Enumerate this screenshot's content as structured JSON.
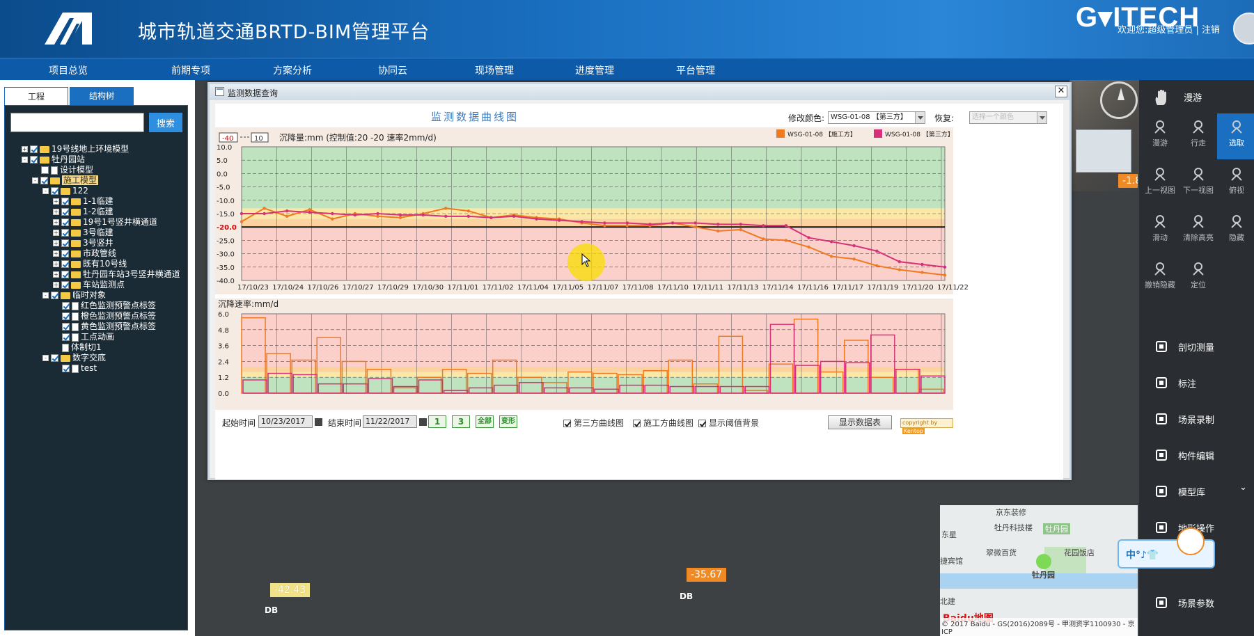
{
  "header": {
    "title": "城市轨道交通BRTD-BIM管理平台",
    "brand": "G▾ITECH",
    "welcome": "欢迎您:超级管理员 | 注销"
  },
  "nav": [
    "项目总览",
    "前期专项",
    "方案分析",
    "协同云",
    "现场管理",
    "进度管理",
    "平台管理"
  ],
  "left_panel": {
    "tabs": [
      "工程",
      "结构树"
    ],
    "search_placeholder": "",
    "search_button": "搜索",
    "tree": [
      {
        "label": "19号线地上环境模型",
        "indent": 0,
        "exp": "+",
        "cb": true,
        "icon": "folder"
      },
      {
        "label": "牡丹园站",
        "indent": 0,
        "exp": "-",
        "cb": true,
        "icon": "folder"
      },
      {
        "label": "设计模型",
        "indent": 1,
        "exp": "",
        "cb": false,
        "icon": "doc"
      },
      {
        "label": "施工模型",
        "indent": 1,
        "exp": "-",
        "cb": true,
        "icon": "folder",
        "highlight": true
      },
      {
        "label": "122",
        "indent": 2,
        "exp": "-",
        "cb": true,
        "icon": "folder"
      },
      {
        "label": "1-1临建",
        "indent": 3,
        "exp": "+",
        "cb": true,
        "icon": "folder"
      },
      {
        "label": "1-2临建",
        "indent": 3,
        "exp": "+",
        "cb": true,
        "icon": "folder"
      },
      {
        "label": "19号1号竖井横通道",
        "indent": 3,
        "exp": "+",
        "cb": true,
        "icon": "folder"
      },
      {
        "label": "3号临建",
        "indent": 3,
        "exp": "+",
        "cb": true,
        "icon": "folder"
      },
      {
        "label": "3号竖井",
        "indent": 3,
        "exp": "+",
        "cb": true,
        "icon": "folder"
      },
      {
        "label": "市政管线",
        "indent": 3,
        "exp": "+",
        "cb": true,
        "icon": "folder"
      },
      {
        "label": "既有10号线",
        "indent": 3,
        "exp": "+",
        "cb": true,
        "icon": "folder"
      },
      {
        "label": "牡丹园车站3号竖井横通道",
        "indent": 3,
        "exp": "+",
        "cb": true,
        "icon": "folder"
      },
      {
        "label": "车站监测点",
        "indent": 3,
        "exp": "+",
        "cb": true,
        "icon": "folder"
      },
      {
        "label": "临时对象",
        "indent": 2,
        "exp": "-",
        "cb": true,
        "icon": "folder"
      },
      {
        "label": "红色监测预警点标签",
        "indent": 3,
        "exp": "",
        "cb": true,
        "icon": "doc"
      },
      {
        "label": "橙色监测预警点标签",
        "indent": 3,
        "exp": "",
        "cb": true,
        "icon": "doc"
      },
      {
        "label": "黄色监测预警点标签",
        "indent": 3,
        "exp": "",
        "cb": true,
        "icon": "doc"
      },
      {
        "label": "工点动画",
        "indent": 3,
        "exp": "",
        "cb": true,
        "icon": "doc"
      },
      {
        "label": "体制切1",
        "indent": 3,
        "exp": "",
        "cb": false,
        "icon": "doc",
        "nocb": true
      },
      {
        "label": "数字交底",
        "indent": 2,
        "exp": "-",
        "cb": true,
        "icon": "folder"
      },
      {
        "label": "test",
        "indent": 3,
        "exp": "",
        "cb": true,
        "icon": "doc"
      }
    ]
  },
  "right_toolbar": {
    "top_item": "漫游",
    "grid": [
      {
        "label": "漫游",
        "icon": "hand-icon"
      },
      {
        "label": "行走",
        "icon": "footprint-icon"
      },
      {
        "label": "选取",
        "icon": "cursor-icon",
        "active": true
      },
      {
        "label": "上一视图",
        "icon": "arrow-left-icon"
      },
      {
        "label": "下一视图",
        "icon": "arrow-right-icon"
      },
      {
        "label": "俯视",
        "icon": "map-icon"
      },
      {
        "label": "滑动",
        "icon": "eye-icon"
      },
      {
        "label": "清除高亮",
        "icon": "cube-icon"
      },
      {
        "label": "隐藏",
        "icon": "person-icon"
      },
      {
        "label": "撤销隐藏",
        "icon": "person-icon"
      },
      {
        "label": "定位",
        "icon": "person-icon"
      }
    ],
    "rows": [
      {
        "label": "剖切测量",
        "icon": "cut-icon"
      },
      {
        "label": "标注",
        "icon": "note-icon"
      },
      {
        "label": "场景录制",
        "icon": "camera-icon"
      },
      {
        "label": "构件编辑",
        "icon": "wrench-icon"
      },
      {
        "label": "模型库",
        "icon": "library-icon"
      },
      {
        "label": "地形操作",
        "icon": "terrain-icon"
      },
      {
        "label": "场景参数",
        "icon": "gear-icon"
      }
    ]
  },
  "scene": {
    "tags": [
      {
        "value": "-42.43",
        "style": "yellow"
      },
      {
        "value": "-35.67",
        "style": "orange"
      },
      {
        "value": "-1.8",
        "style": "orange"
      }
    ],
    "db_label": "DB",
    "map": {
      "labels": [
        "牡丹科技楼",
        "牡丹园",
        "东星",
        "翠微百货",
        "花园饭店",
        "牡丹园",
        "捷宾馆",
        "北建",
        "京东装修"
      ],
      "baidu": "Baidu地图",
      "copyright": "© 2017 Baidu - GS(2016)2089号 - 甲测资字1100930 - 京ICP"
    },
    "mascot": "中°♪👕"
  },
  "dialog": {
    "title": "监测数据查询",
    "close": "✕",
    "chart_title": "监测数据曲线图",
    "color_label": "修改颜色:",
    "color_select": "WSG-01-08 【第三方】",
    "restore_label": "恢复:",
    "restore_select": "选择一个颜色",
    "legend_box1": "-40",
    "legend_box2": "10",
    "chart1_caption": "沉降量:mm (控制值:20 -20 速率2mm/d)",
    "chart2_caption": "沉降速率:mm/d",
    "start_label": "起始时间",
    "start_value": "10/23/2017",
    "end_label": "结束时间",
    "end_value": "11/22/2017",
    "btn1": "1",
    "btn3": "3",
    "btn_all": "全部",
    "btn_deform": "变形",
    "chk_third": "第三方曲线图",
    "chk_construct": "施工方曲线图",
    "chk_threshold": "显示阈值背景",
    "show_table": "显示数据表",
    "copyright_label": "copyright by",
    "copyright_brand": "Kentop"
  },
  "chart_data": [
    {
      "type": "line",
      "title": "",
      "ylabel": "沉降量:mm (控制值:20 -20 速率2mm/d)",
      "ylim": [
        -40,
        10
      ],
      "yticks": [
        10,
        5,
        0,
        -5,
        -10,
        -15,
        -20,
        -25,
        -30,
        -35,
        -40
      ],
      "x_labels": [
        "17/10/23",
        "17/10/24",
        "17/10/26",
        "17/10/27",
        "17/10/29",
        "17/10/30",
        "17/11/01",
        "17/11/02",
        "17/11/04",
        "17/11/05",
        "17/11/07",
        "17/11/08",
        "17/11/10",
        "17/11/11",
        "17/11/13",
        "17/11/14",
        "17/11/16",
        "17/11/17",
        "17/11/19",
        "17/11/20",
        "17/11/22"
      ],
      "control_line": -20,
      "colors": {
        "construct": "#f07a22",
        "third": "#d6307a"
      },
      "series": [
        {
          "name": "WSG-01-08 【施工方】",
          "color": "#f07a22",
          "values": [
            -18,
            -13,
            -16,
            -13.5,
            -17,
            -15,
            -16,
            -16.5,
            -15,
            -13,
            -14,
            -16.5,
            -15.5,
            -16.5,
            -17,
            -18.5,
            -19.5,
            -19.5,
            -19.5,
            -18.5,
            -20,
            -21.5,
            -21,
            -24.5,
            -25,
            -27.5,
            -31,
            -32,
            -34.5,
            -36,
            -37,
            -38
          ]
        },
        {
          "name": "WSG-01-08 【第三方】",
          "color": "#d6307a",
          "values": [
            -15,
            -15,
            -14,
            -14.5,
            -15,
            -15.5,
            -15,
            -15.5,
            -15.5,
            -16,
            -16,
            -16.5,
            -16,
            -17,
            -17.5,
            -18,
            -18.5,
            -18.5,
            -19,
            -18.5,
            -18.5,
            -19,
            -19,
            -19.5,
            -19.5,
            -24,
            -25.5,
            -27,
            -29,
            -33,
            -34,
            -35
          ]
        }
      ],
      "bands": [
        {
          "from": 10,
          "to": -13,
          "color": "#bfe2bf"
        },
        {
          "from": -13,
          "to": -17,
          "color": "#fbe7a6"
        },
        {
          "from": -17,
          "to": -20,
          "color": "#fbd2a0"
        },
        {
          "from": -20,
          "to": -40,
          "color": "#fbd0cb"
        }
      ]
    },
    {
      "type": "bar",
      "title": "",
      "ylabel": "沉降速率:mm/d",
      "ylim": [
        0,
        6
      ],
      "yticks": [
        "6.0",
        "4.8",
        "3.6",
        "2.4",
        "1.2",
        "0.0"
      ],
      "series": [
        {
          "name": "WSG-01-08 【施工方】",
          "color": "#f07a22",
          "values": [
            5.7,
            3.0,
            2.5,
            4.2,
            2.4,
            1.8,
            0.4,
            1.2,
            1.8,
            1.5,
            2.5,
            1.2,
            0.8,
            1.6,
            1.5,
            1.4,
            1.7,
            2.5,
            0.7,
            4.3,
            0.2,
            2.2,
            5.6,
            1.6,
            4.0,
            1.2,
            1.8,
            0.3
          ]
        },
        {
          "name": "WSG-01-08 【第三方】",
          "color": "#d6307a",
          "values": [
            1.0,
            1.5,
            1.4,
            0.7,
            0.7,
            1.1,
            0.5,
            1.0,
            0.2,
            0.4,
            0.6,
            0.8,
            0.4,
            0.4,
            0.3,
            0.6,
            0.6,
            0.5,
            0.5,
            0.5,
            0.5,
            5.2,
            2.1,
            2.4,
            2.3,
            4.4,
            1.8,
            1.3
          ]
        }
      ],
      "bands": [
        {
          "from": 6,
          "to": 2,
          "color": "#fbd0cb"
        },
        {
          "from": 2,
          "to": 1.6,
          "color": "#fbd2a0"
        },
        {
          "from": 1.6,
          "to": 1.2,
          "color": "#fbe7a6"
        },
        {
          "from": 1.2,
          "to": 0,
          "color": "#bfe2bf"
        }
      ]
    }
  ]
}
